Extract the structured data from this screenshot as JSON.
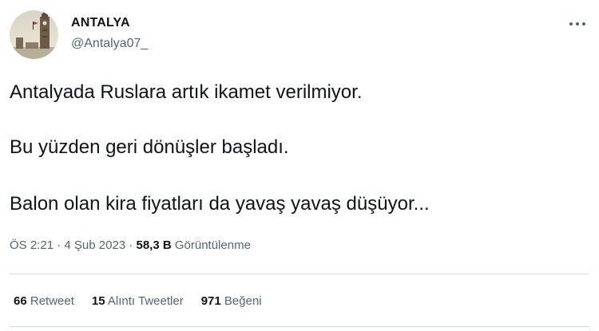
{
  "author": {
    "display_name": "ANTALYA",
    "username": "@Antalya07_"
  },
  "tweet": {
    "lines": [
      "Antalyada Ruslara artık ikamet verilmiyor.",
      "Bu yüzden geri dönüşler başladı.",
      "Balon olan kira fiyatları da yavaş yavaş düşüyor..."
    ]
  },
  "meta": {
    "time": "ÖS 2:21",
    "separator": "·",
    "date": "4 Şub 2023",
    "views_count": "58,3 B",
    "views_label": "Görüntülenme"
  },
  "stats": {
    "retweets_count": "66",
    "retweets_label": "Retweet",
    "quotes_count": "15",
    "quotes_label": "Alıntı Tweetler",
    "likes_count": "971",
    "likes_label": "Beğeni"
  },
  "icons": {
    "more": "more-horizontal-icon"
  },
  "colors": {
    "text_primary": "#0f1419",
    "text_secondary": "#536471",
    "divider": "#cfd9de"
  }
}
